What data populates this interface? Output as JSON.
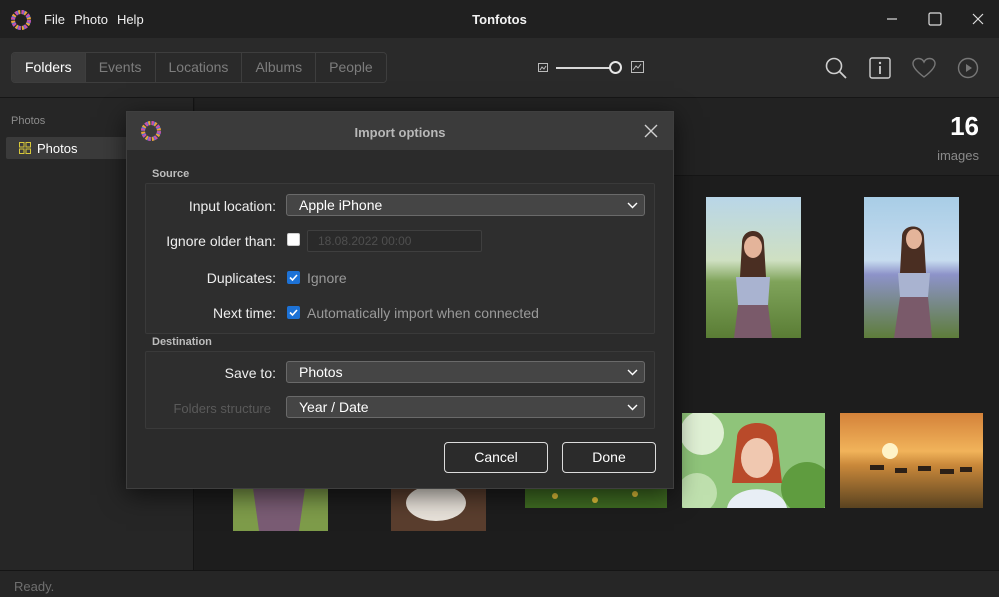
{
  "app": {
    "title": "Tonfotos",
    "menu": [
      "File",
      "Photo",
      "Help"
    ]
  },
  "toolbar": {
    "tabs": [
      {
        "label": "Folders",
        "active": true
      },
      {
        "label": "Events",
        "active": false
      },
      {
        "label": "Locations",
        "active": false
      },
      {
        "label": "Albums",
        "active": false
      },
      {
        "label": "People",
        "active": false
      }
    ]
  },
  "sidebar": {
    "heading": "Photos",
    "items": [
      {
        "label": "Photos",
        "icon": "grid-icon",
        "selected": true
      }
    ]
  },
  "content": {
    "count": "16",
    "count_label": "images"
  },
  "status": {
    "text": "Ready."
  },
  "dialog": {
    "title": "Import options",
    "source_label": "Source",
    "destination_label": "Destination",
    "input_location_label": "Input location:",
    "input_location_value": "Apple iPhone",
    "ignore_older_label": "Ignore older than:",
    "ignore_older_checked": false,
    "ignore_older_date": "18.08.2022 00:00",
    "duplicates_label": "Duplicates:",
    "duplicates_text": "Ignore",
    "duplicates_checked": true,
    "next_time_label": "Next time:",
    "next_time_text": "Automatically import when connected",
    "next_time_checked": true,
    "save_to_label": "Save to:",
    "save_to_value": "Photos",
    "folders_structure_label": "Folders structure",
    "folders_structure_value": "Year / Date",
    "cancel_label": "Cancel",
    "done_label": "Done"
  },
  "colors": {
    "accent": "#1d72d6",
    "background": "#1e1e1e",
    "dialog_bg": "#2b2b2b"
  }
}
